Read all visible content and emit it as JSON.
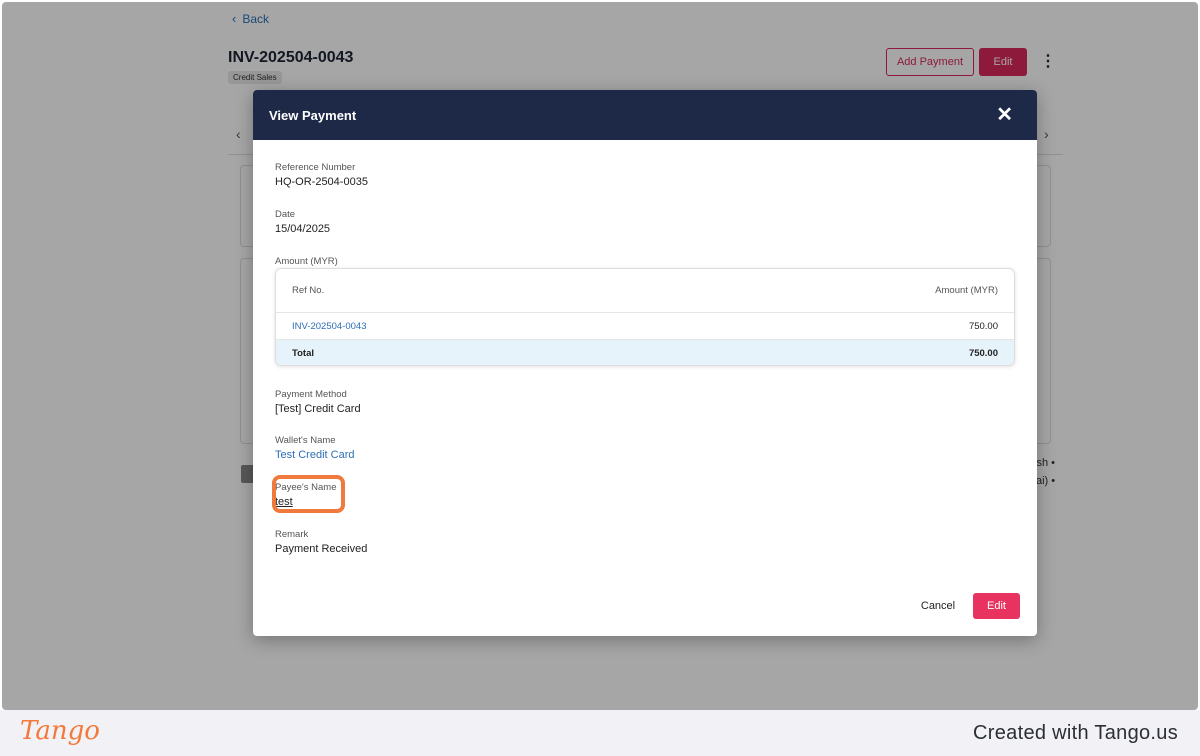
{
  "background": {
    "back_label": "Back",
    "invoice_title": "INV-202504-0043",
    "badge": "Credit Sales",
    "add_payment_label": "Add Payment",
    "edit_label": "Edit",
    "side_text_1": "ish •",
    "side_text_2": "ai) •"
  },
  "modal": {
    "title": "View Payment",
    "reference_number": {
      "label": "Reference Number",
      "value": "HQ-OR-2504-0035"
    },
    "date": {
      "label": "Date",
      "value": "15/04/2025"
    },
    "amount": {
      "label": "Amount (MYR)",
      "columns": [
        "Ref No.",
        "Amount (MYR)"
      ],
      "rows": [
        {
          "ref": "INV-202504-0043",
          "amount": "750.00"
        }
      ],
      "total_label": "Total",
      "total_value": "750.00"
    },
    "payment_method": {
      "label": "Payment Method",
      "value": "[Test] Credit Card"
    },
    "wallet_name": {
      "label": "Wallet's Name",
      "value": "Test Credit Card"
    },
    "payee_name": {
      "label": "Payee's Name",
      "value": "test"
    },
    "remark": {
      "label": "Remark",
      "value": "Payment Received"
    },
    "cancel_label": "Cancel",
    "edit_label": "Edit"
  },
  "footer": {
    "logo_text": "Tango",
    "created_text": "Created with Tango.us"
  },
  "colors": {
    "modal_header": "#1e2947",
    "accent": "#e8325f",
    "link": "#2d6fb7",
    "highlight": "#f07a3d"
  }
}
